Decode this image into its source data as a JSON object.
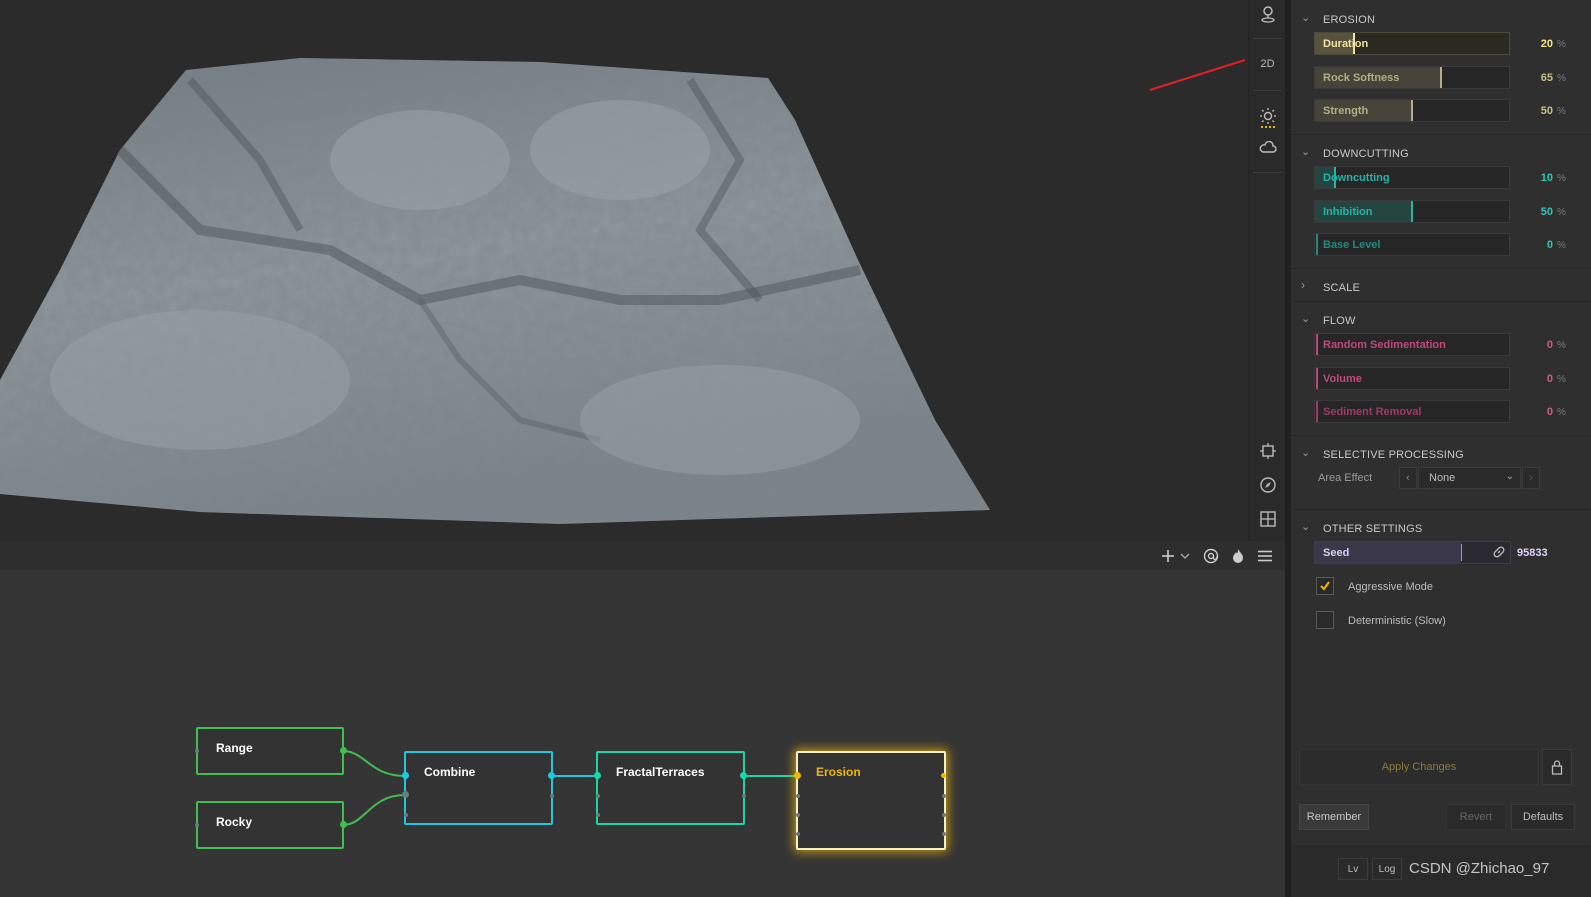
{
  "viewport": {
    "toolbar": {
      "mode_label": "2D",
      "icons": [
        "pin-icon",
        "sun-icon",
        "cloud-icon",
        "frame-icon",
        "compass-icon",
        "grid-icon"
      ]
    },
    "terrain_color": "#8e979d"
  },
  "graph_toolbar": {
    "icons": [
      "plus-icon",
      "chevron-down-icon",
      "at-icon",
      "flame-icon",
      "menu-icon"
    ]
  },
  "graph": {
    "nodes": [
      {
        "id": "range",
        "label": "Range",
        "color": "#3fbf4f"
      },
      {
        "id": "rocky",
        "label": "Rocky",
        "color": "#3fbf4f"
      },
      {
        "id": "combine",
        "label": "Combine",
        "color": "#1fc8e0"
      },
      {
        "id": "fractal",
        "label": "FractalTerraces",
        "color": "#19d8a8"
      },
      {
        "id": "erosion",
        "label": "Erosion",
        "color": "#f2b705"
      }
    ]
  },
  "panel": {
    "erosion": {
      "title": "EROSION",
      "params": [
        {
          "label": "Duration",
          "value": "20",
          "unit": "%",
          "fraction": 0.2,
          "color": "#f4e3a2",
          "valcolor": "#f7e48a"
        },
        {
          "label": "Rock Softness",
          "value": "65",
          "unit": "%",
          "fraction": 0.65,
          "color": "#b5ad86",
          "valcolor": "#c8bf86"
        },
        {
          "label": "Strength",
          "value": "50",
          "unit": "%",
          "fraction": 0.5,
          "color": "#b5ad86",
          "valcolor": "#c8bf86"
        }
      ]
    },
    "downcutting": {
      "title": "DOWNCUTTING",
      "params": [
        {
          "label": "Downcutting",
          "value": "10",
          "unit": "%",
          "fraction": 0.1,
          "color": "#26b4a6",
          "valcolor": "#2fc6b6"
        },
        {
          "label": "Inhibition",
          "value": "50",
          "unit": "%",
          "fraction": 0.5,
          "color": "#26b4a6",
          "valcolor": "#2fc6b6"
        },
        {
          "label": "Base Level",
          "value": "0",
          "unit": "%",
          "fraction": 0.0,
          "color": "#228a80",
          "valcolor": "#2fc6b6"
        }
      ]
    },
    "scale": {
      "title": "SCALE"
    },
    "flow": {
      "title": "FLOW",
      "params": [
        {
          "label": "Random Sedimentation",
          "value": "0",
          "unit": "%",
          "fraction": 0.0,
          "color": "#c0487a",
          "valcolor": "#d05a8a"
        },
        {
          "label": "Volume",
          "value": "0",
          "unit": "%",
          "fraction": 0.0,
          "color": "#c0487a",
          "valcolor": "#d05a8a"
        },
        {
          "label": "Sediment Removal",
          "value": "0",
          "unit": "%",
          "fraction": 0.0,
          "color": "#a03a64",
          "valcolor": "#d05a8a"
        }
      ]
    },
    "selective": {
      "title": "SELECTIVE PROCESSING",
      "area_effect_label": "Area Effect",
      "area_effect_value": "None"
    },
    "other": {
      "title": "OTHER SETTINGS",
      "seed_label": "Seed",
      "seed_value": "95833",
      "aggressive_label": "Aggressive Mode",
      "aggressive_checked": true,
      "deterministic_label": "Deterministic (Slow)",
      "deterministic_checked": false
    },
    "buttons": {
      "apply": "Apply Changes",
      "remember": "Remember",
      "revert": "Revert",
      "defaults": "Defaults"
    },
    "footer": {
      "tabs": [
        "Lv",
        "Log"
      ],
      "watermark": "CSDN @Zhichao_97"
    }
  }
}
